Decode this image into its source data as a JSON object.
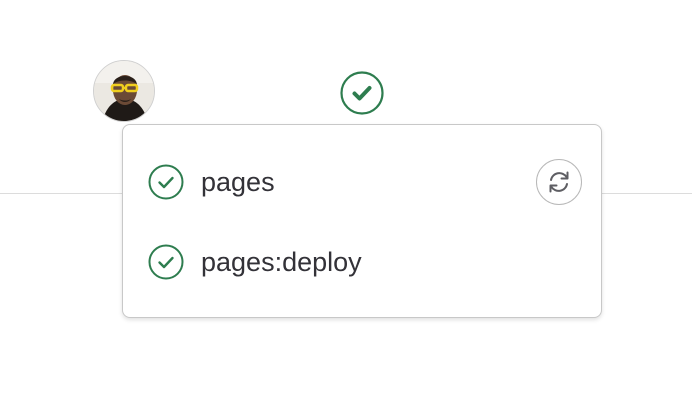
{
  "pipeline": {
    "status": "passed",
    "status_icon": "check-circle-icon",
    "success_color": "#2e7d4f"
  },
  "commit": {
    "author_avatar": "user-avatar"
  },
  "jobs_dropdown": {
    "jobs": [
      {
        "name": "pages",
        "status": "passed",
        "status_icon": "check-circle-icon",
        "action_icon": "retry-icon"
      },
      {
        "name": "pages:deploy",
        "status": "passed",
        "status_icon": "check-circle-icon"
      }
    ]
  },
  "colors": {
    "text": "#333238",
    "border": "#c8c8c8",
    "divider": "#dcdcdc"
  }
}
